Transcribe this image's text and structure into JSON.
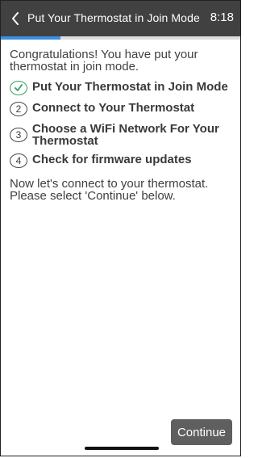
{
  "header": {
    "title": "Put Your Thermostat in Join Mode",
    "time": "8:18",
    "back_icon": "chevron-left-icon"
  },
  "progress": {
    "fraction": 0.25,
    "fill_color": "#3b8fe0",
    "track_color": "#dcdcdc"
  },
  "main": {
    "intro": "Congratulations! You have put your thermostat in join mode.",
    "steps": [
      {
        "marker": "",
        "label": "Put Your Thermostat in Join Mode",
        "status": "complete",
        "icon": "check-circle-icon"
      },
      {
        "marker": "2",
        "label": "Connect to Your Thermostat",
        "status": "pending"
      },
      {
        "marker": "3",
        "label": "Choose a WiFi Network For Your Thermostat",
        "status": "pending"
      },
      {
        "marker": "4",
        "label": "Check for firmware updates",
        "status": "pending"
      }
    ],
    "outro": "Now let's connect to your thermostat. Please select 'Continue' below."
  },
  "footer": {
    "continue_label": "Continue"
  },
  "colors": {
    "header_bg": "#414141",
    "check_green": "#38a169",
    "button_bg": "#5f5f5f"
  }
}
